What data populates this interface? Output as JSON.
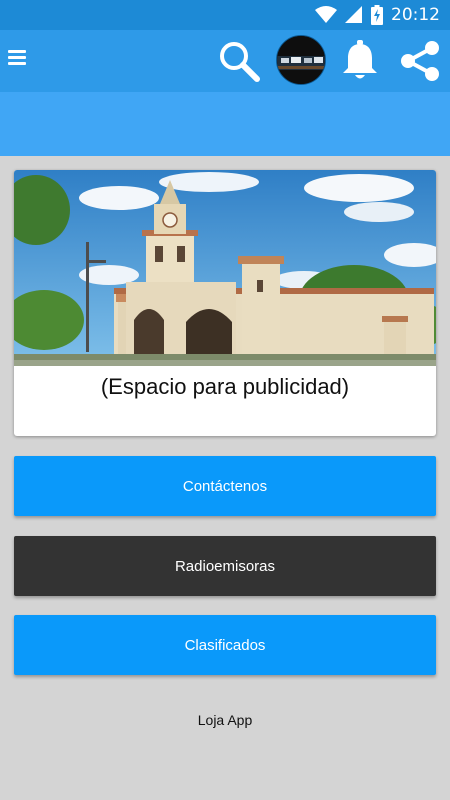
{
  "status_bar": {
    "time": "20:12",
    "icons": [
      "wifi-icon",
      "signal-icon",
      "battery-charging-icon"
    ]
  },
  "app_bar": {
    "icons": [
      "menu-icon",
      "search-icon",
      "avatar",
      "bell-icon",
      "share-icon"
    ]
  },
  "ad": {
    "text": "(Espacio para publicidad)"
  },
  "buttons": {
    "contact": "Contáctenos",
    "radio": "Radioemisoras",
    "classifieds": "Clasificados"
  },
  "footer": {
    "text": "Loja App"
  },
  "colors": {
    "status_bar": "#1d8ad6",
    "app_bar": "#2e9ae8",
    "sub_bar": "#40a6f5",
    "primary_button": "#0a99fa",
    "dark_button": "#333333",
    "background": "#d4d4d4"
  }
}
